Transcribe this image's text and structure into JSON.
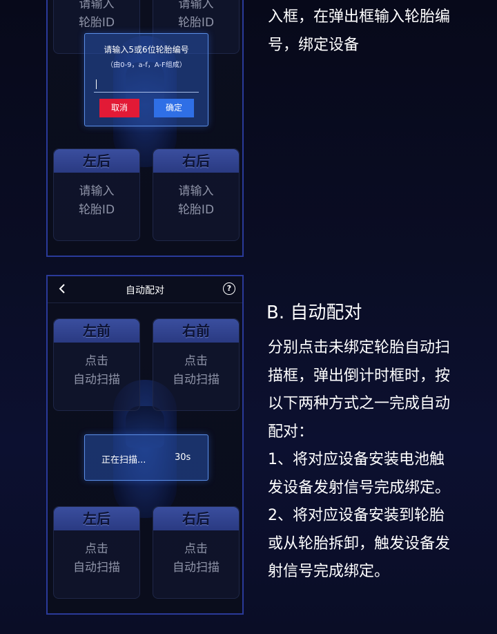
{
  "phone1": {
    "tires": {
      "front_left": {
        "body": [
          "请输入",
          "轮胎ID"
        ]
      },
      "front_right": {
        "body": [
          "请输入",
          "轮胎ID"
        ]
      },
      "rear_left": {
        "label": "左后",
        "body": [
          "请输入",
          "轮胎ID"
        ]
      },
      "rear_right": {
        "label": "右后",
        "body": [
          "请输入",
          "轮胎ID"
        ]
      }
    },
    "dialog": {
      "title": "请输入5或6位轮胎编号",
      "hint": "（由0-9，a-f，A-F组成）",
      "input_value": "",
      "cancel_label": "取消",
      "ok_label": "确定"
    }
  },
  "phone2": {
    "nav": {
      "title": "自动配对",
      "back_icon": "chevron-left-icon",
      "help_icon": "question-circle-icon"
    },
    "tires": {
      "front_left": {
        "label": "左前",
        "body": [
          "点击",
          "自动扫描"
        ]
      },
      "front_right": {
        "label": "右前",
        "body": [
          "点击",
          "自动扫描"
        ]
      },
      "rear_left": {
        "label": "左后",
        "body": [
          "点击",
          "自动扫描"
        ]
      },
      "rear_right": {
        "label": "右后",
        "body": [
          "点击",
          "自动扫描"
        ]
      }
    },
    "scan_dialog": {
      "text": "正在扫描...",
      "countdown": "30s"
    }
  },
  "right": {
    "top_lines": [
      "入框，在弹出框输入轮胎编",
      "号，绑定设备"
    ],
    "section_title": "B. 自动配对",
    "lines": [
      "分别点击未绑定轮胎自动扫",
      "描框，弹出倒计时框时，按",
      "以下两种方式之一完成自动",
      "配对：",
      "1、将对应设备安装电池触",
      "发设备发射信号完成绑定。",
      "2、将对应设备安装到轮胎",
      "或从轮胎拆卸，触发设备发",
      "射信号完成绑定。"
    ]
  }
}
